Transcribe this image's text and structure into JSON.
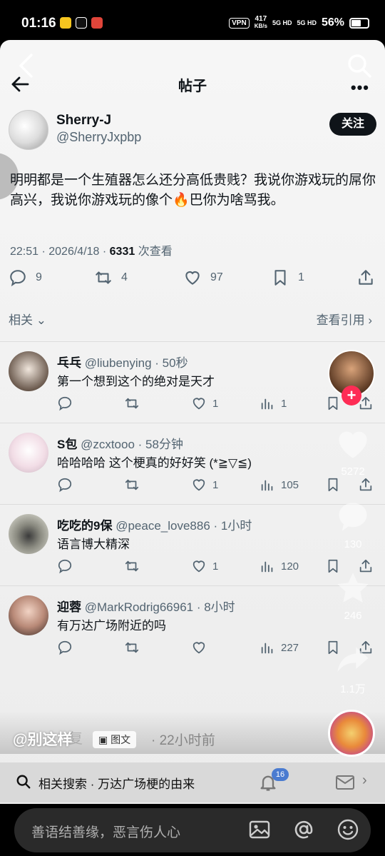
{
  "status_bar": {
    "time": "01:16",
    "vpn": "VPN",
    "speed_value": "417",
    "speed_unit": "KB/s",
    "signal1": "5G HD",
    "signal2": "5G HD",
    "battery": "56%"
  },
  "header": {
    "title": "帖子",
    "more": "•••"
  },
  "author": {
    "name": "Sherry-J",
    "handle": "@SherryJxpbp",
    "follow_label": "关注"
  },
  "post": {
    "text": "明明都是一个生殖器怎么还分高低贵贱？我说你游戏玩的屌你高兴，我说你游戏玩的像个🔥巴你为啥骂我。",
    "timestamp": "22:51 · 2026/4/18 · ",
    "views": "6331",
    "views_label": " 次查看",
    "replies": "9",
    "reposts": "4",
    "likes": "97",
    "bookmarks": "1"
  },
  "related": {
    "left_label": "相关",
    "right_label": "查看引用"
  },
  "replies": [
    {
      "name": "乓乓",
      "meta": "@liubenying · 50秒",
      "text": "第一个想到这个的绝对是天才",
      "likes": "1",
      "views": "1"
    },
    {
      "name": "S包",
      "meta": "@zcxtooo · 58分钟",
      "text": "哈哈哈哈 这个梗真的好好笑 (*≧▽≦)",
      "likes": "1",
      "views": "105"
    },
    {
      "name": "吃吃的9保",
      "meta": "@peace_love886 · 1小时",
      "text": "语言博大精深",
      "likes": "1",
      "views": "120"
    },
    {
      "name": "迎蓉",
      "meta": "@MarkRodrig66961 · 8小时",
      "text": "有万达广场附近的吗",
      "likes": "",
      "views": "227"
    }
  ],
  "float_panel": {
    "likes": "5272",
    "comments": "130",
    "favorites": "246",
    "shares": "1.1万"
  },
  "caption": {
    "user": "@别这样",
    "ghost_text": "复",
    "badge": "图文",
    "time": "· 22小时前"
  },
  "search_strip": {
    "text": "相关搜索 · 万达广场梗的由来",
    "badge": "16"
  },
  "comment_bar": {
    "placeholder": "善语结善缘，恶言伤人心"
  },
  "colors": {
    "accent": "#fe2c55",
    "text_primary": "#0f1419",
    "text_secondary": "#536471"
  }
}
